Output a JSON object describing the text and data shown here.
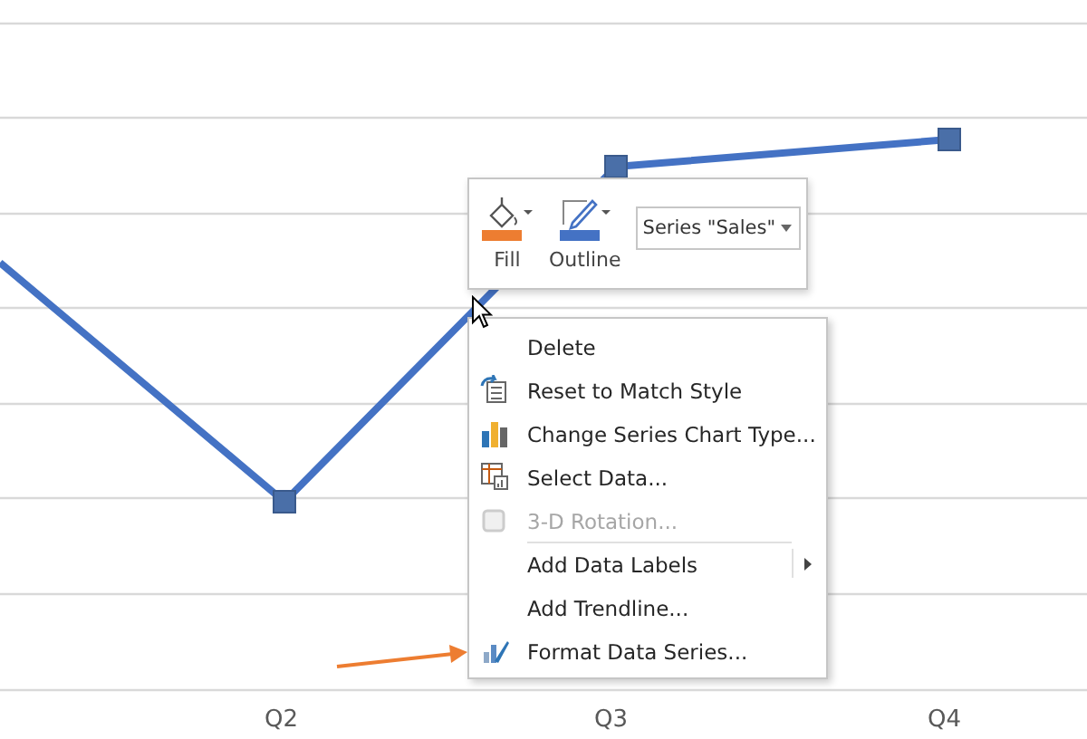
{
  "chart": {
    "x_axis_labels": [
      "Q2",
      "Q3",
      "Q4"
    ]
  },
  "mini_toolbar": {
    "buttons": [
      {
        "kind": "fill",
        "label": "Fill",
        "color": "#ed7d31"
      },
      {
        "kind": "outline",
        "label": "Outline",
        "color": "#4472c4"
      }
    ],
    "dropdown": {
      "value": "Series \"Sales\""
    }
  },
  "context_menu": {
    "items": [
      {
        "kind": "delete",
        "label": "Delete",
        "disabled": false,
        "submenu": false,
        "separator_before": false
      },
      {
        "kind": "reset",
        "label": "Reset to Match Style",
        "disabled": false,
        "submenu": false,
        "separator_before": false
      },
      {
        "kind": "chart-type",
        "label": "Change Series Chart Type...",
        "disabled": false,
        "submenu": false,
        "separator_before": false
      },
      {
        "kind": "select-data",
        "label": "Select Data...",
        "disabled": false,
        "submenu": false,
        "separator_before": false
      },
      {
        "kind": "rotation",
        "label": "3-D Rotation...",
        "disabled": true,
        "submenu": false,
        "separator_before": false
      },
      {
        "kind": "none",
        "label": "Add Data Labels",
        "disabled": false,
        "submenu": true,
        "separator_before": true
      },
      {
        "kind": "none",
        "label": "Add Trendline...",
        "disabled": false,
        "submenu": false,
        "separator_before": false
      },
      {
        "kind": "format",
        "label": "Format Data Series...",
        "disabled": false,
        "submenu": false,
        "separator_before": false
      }
    ]
  }
}
